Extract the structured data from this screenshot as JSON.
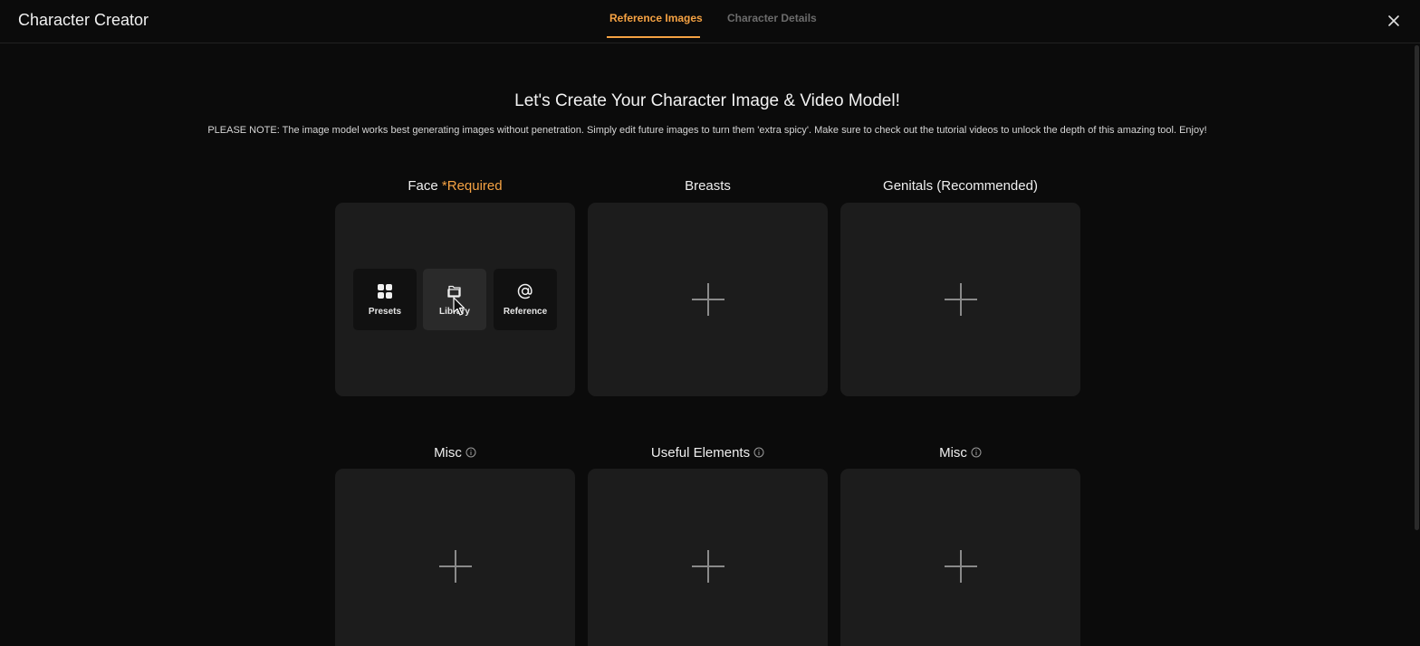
{
  "app": {
    "title": "Character Creator"
  },
  "tabs": [
    {
      "label": "Reference Images",
      "active": true
    },
    {
      "label": "Character Details",
      "active": false
    }
  ],
  "accent_color": "#f5a243",
  "main": {
    "heading": "Let's Create Your Character Image & Video Model!",
    "note": "PLEASE NOTE: The image model works best generating images without penetration. Simply edit future images to turn them 'extra spicy'. Make sure to check out the tutorial videos to unlock the depth of this amazing tool. Enjoy!"
  },
  "slots": [
    {
      "label": "Face",
      "required_label": "*Required",
      "options": [
        {
          "label": "Presets",
          "icon": "grid-icon"
        },
        {
          "label": "Library",
          "icon": "folder-icon"
        },
        {
          "label": "Reference",
          "icon": "at-sign-icon"
        }
      ]
    },
    {
      "label": "Breasts"
    },
    {
      "label": "Genitals (Recommended)"
    },
    {
      "label": "Misc",
      "info": true
    },
    {
      "label": "Useful Elements",
      "info": true
    },
    {
      "label": "Misc",
      "info": true
    }
  ]
}
